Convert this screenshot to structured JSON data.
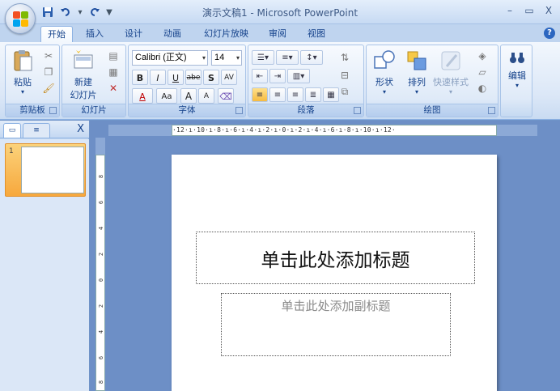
{
  "window": {
    "title": "演示文稿1 - Microsoft PowerPoint",
    "minimize_icon": "minimize-icon",
    "maximize_icon": "maximize-icon",
    "close_label": "X"
  },
  "qat": {
    "save_icon": "save-icon",
    "undo_icon": "undo-icon",
    "redo_icon": "redo-icon",
    "customize_label": "▼"
  },
  "tabs": [
    {
      "label": "开始",
      "active": true
    },
    {
      "label": "插入"
    },
    {
      "label": "设计"
    },
    {
      "label": "动画"
    },
    {
      "label": "幻灯片放映"
    },
    {
      "label": "审阅"
    },
    {
      "label": "视图"
    }
  ],
  "help_label": "?",
  "groups": {
    "clipboard": {
      "label": "剪贴板",
      "paste_label": "粘贴"
    },
    "slides": {
      "label": "幻灯片",
      "new_slide_label": "新建",
      "new_slide_label2": "幻灯片"
    },
    "font": {
      "label": "字体",
      "font_name": "Calibri (正文)",
      "font_size": "14",
      "bold": "B",
      "italic": "I",
      "underline": "U",
      "strike": "abe",
      "shadow": "S",
      "spacing": "AV",
      "font_color": "A",
      "change_case": "Aa",
      "grow": "A",
      "shrink": "A"
    },
    "paragraph": {
      "label": "段落"
    },
    "drawing": {
      "label": "绘图",
      "shapes_label": "形状",
      "arrange_label": "排列",
      "quick_styles_label": "快速样式"
    },
    "editing": {
      "label": "编辑",
      "find_label": "编辑"
    }
  },
  "left_panel": {
    "close_label": "X",
    "slide_number": "1"
  },
  "ruler": {
    "horizontal": "·12·ı·10·ı·8·ı·6·ı·4·ı·2·ı·0·ı·2·ı·4·ı·6·ı·8·ı·10·ı·12·",
    "vertical_ticks": [
      "8",
      "6",
      "4",
      "2",
      "0",
      "2",
      "4",
      "6",
      "8"
    ]
  },
  "slide": {
    "title_placeholder": "单击此处添加标题",
    "subtitle_placeholder": "单击此处添加副标题"
  }
}
